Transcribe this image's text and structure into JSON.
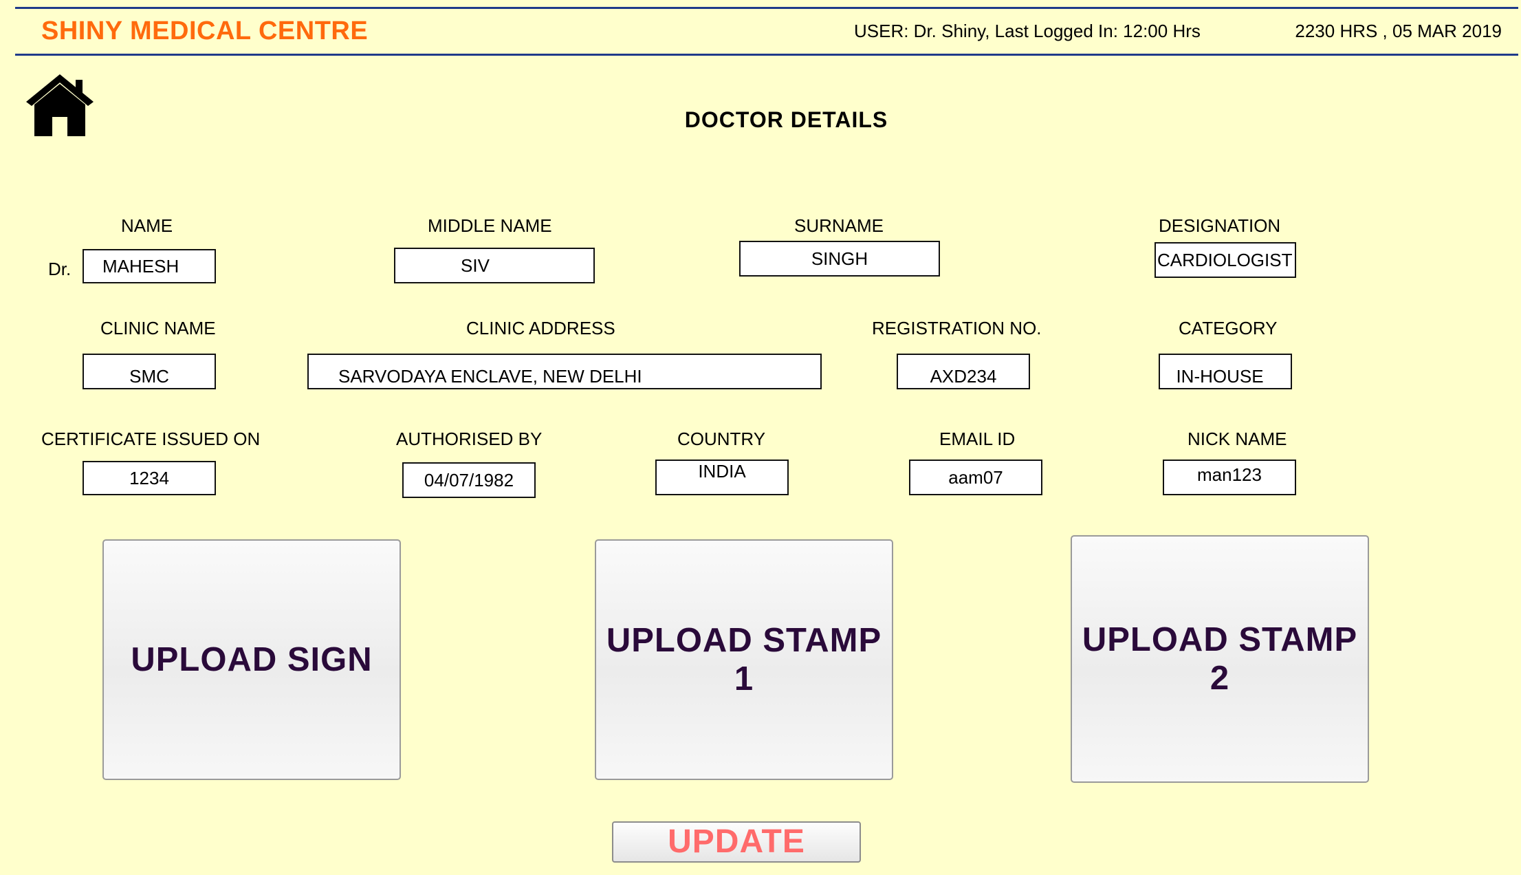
{
  "header": {
    "clinic_name": "SHINY MEDICAL CENTRE",
    "user_info": "USER: Dr. Shiny, Last Logged In: 12:00 Hrs",
    "datetime": "2230 HRS , 05 MAR 2019"
  },
  "page_title": "DOCTOR DETAILS",
  "form": {
    "name_prefix": "Dr.",
    "labels": {
      "name": "NAME",
      "middle_name": "MIDDLE NAME",
      "surname": "SURNAME",
      "designation": "DESIGNATION",
      "clinic_name": "CLINIC NAME",
      "clinic_address": "CLINIC ADDRESS",
      "registration_no": "REGISTRATION NO.",
      "category": "CATEGORY",
      "certificate_issued_on": "CERTIFICATE ISSUED ON",
      "authorised_by": "AUTHORISED BY",
      "country": "COUNTRY",
      "email_id": "EMAIL ID",
      "nick_name": "NICK NAME"
    },
    "values": {
      "name": "MAHESH",
      "middle_name": "SIV",
      "surname": "SINGH",
      "designation": "CARDIOLOGIST",
      "clinic_name": "SMC",
      "clinic_address": "SARVODAYA ENCLAVE, NEW DELHI",
      "registration_no": "AXD234",
      "category": "IN-HOUSE",
      "certificate_issued_on": "1234",
      "authorised_by": "04/07/1982",
      "country": "INDIA",
      "email_id": "aam07",
      "nick_name": "man123"
    }
  },
  "buttons": {
    "upload_sign": "UPLOAD SIGN",
    "upload_stamp_1": "UPLOAD STAMP 1",
    "upload_stamp_2": "UPLOAD STAMP 2",
    "update": "UPDATE"
  },
  "icons": {
    "home": "home-icon"
  },
  "colors": {
    "background": "#ffffcc",
    "brand": "#ff6a0d",
    "header_rule": "#1f3a8a",
    "update_text": "#ff6b6b",
    "upload_text": "#2a0a3a"
  }
}
